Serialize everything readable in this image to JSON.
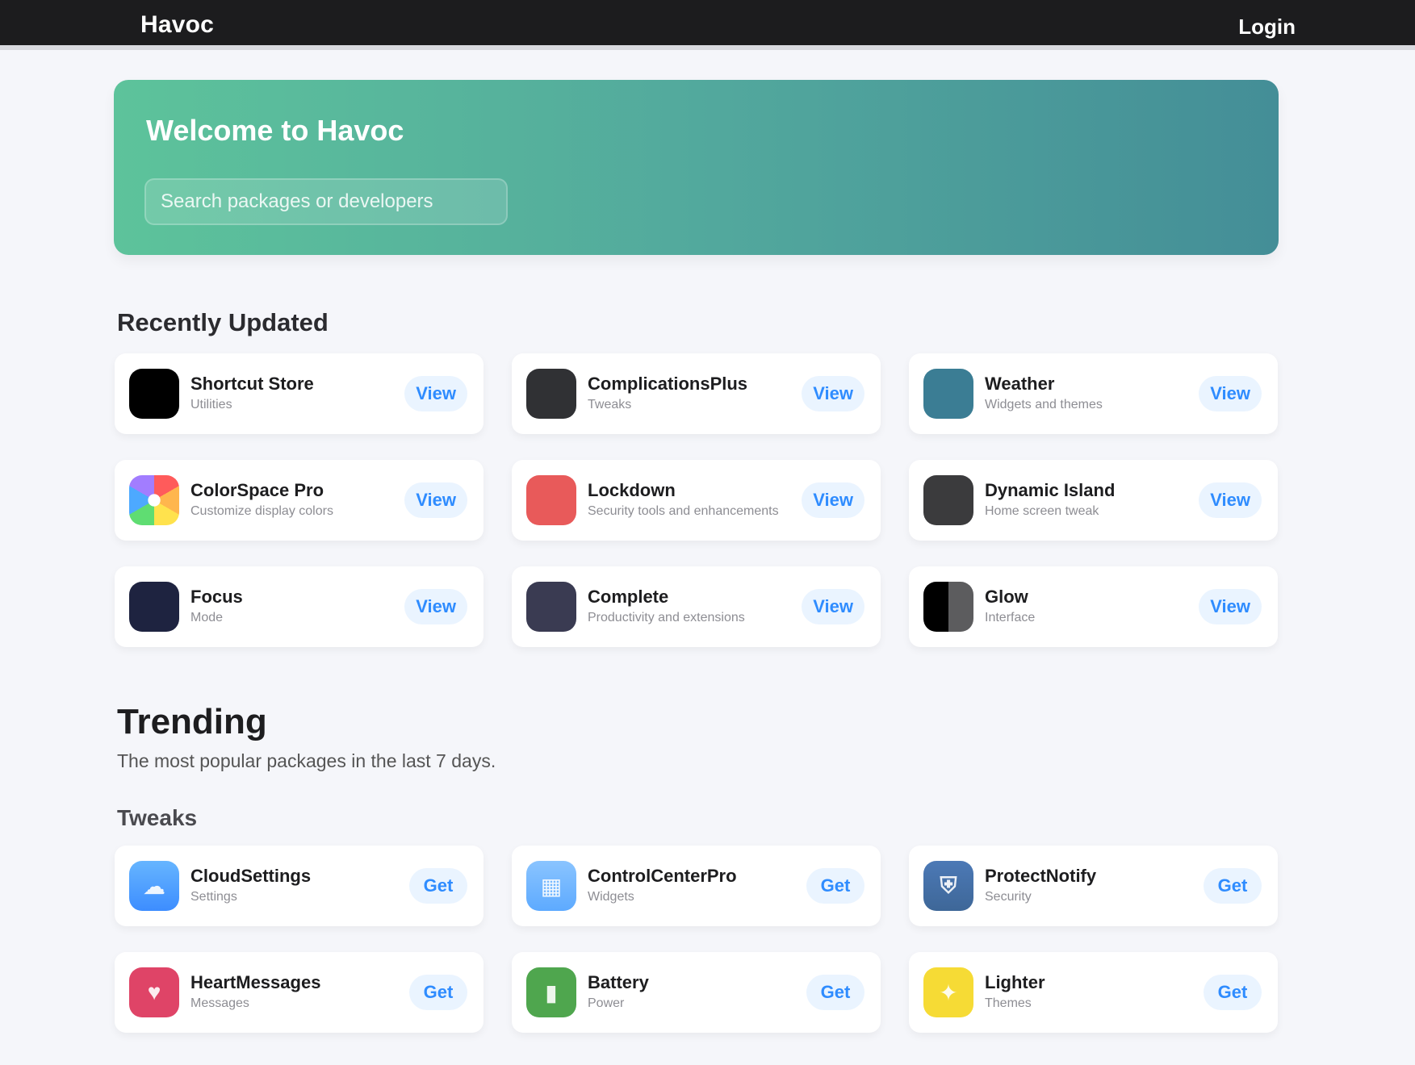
{
  "app": {
    "brand": "Havoc",
    "login": "Login"
  },
  "hero": {
    "title": "Welcome to Havoc",
    "search_placeholder": "Search packages or developers"
  },
  "sections": {
    "recent": {
      "label": "Recently Updated",
      "items": [
        {
          "title": "Shortcut Store",
          "subtitle": "Utilities",
          "button": "View",
          "icon": "app-icon"
        },
        {
          "title": "ComplicationsPlus",
          "subtitle": "Tweaks",
          "button": "View",
          "icon": "app-icon"
        },
        {
          "title": "Weather",
          "subtitle": "Widgets and themes",
          "button": "View",
          "icon": "app-icon"
        },
        {
          "title": "ColorSpace Pro",
          "subtitle": "Customize display colors",
          "button": "View",
          "icon": "color-icon"
        },
        {
          "title": "Lockdown",
          "subtitle": "Security tools and enhancements",
          "button": "View",
          "icon": "app-icon"
        },
        {
          "title": "Dynamic Island",
          "subtitle": "Home screen tweak",
          "button": "View",
          "icon": "app-icon"
        },
        {
          "title": "Focus",
          "subtitle": "Mode",
          "button": "View",
          "icon": "app-icon"
        },
        {
          "title": "Complete",
          "subtitle": "Productivity and extensions",
          "button": "View",
          "icon": "app-icon"
        },
        {
          "title": "Glow",
          "subtitle": "Interface",
          "button": "View",
          "icon": "app-icon"
        }
      ]
    },
    "trending": {
      "title": "Trending",
      "subtitle": "The most popular packages in the last 7 days.",
      "tweaks_label": "Tweaks",
      "items": [
        {
          "title": "CloudSettings",
          "subtitle": "Settings",
          "button": "Get",
          "icon": "cloud-icon"
        },
        {
          "title": "ControlCenterPro",
          "subtitle": "Widgets",
          "button": "Get",
          "icon": "control-icon"
        },
        {
          "title": "ProtectNotify",
          "subtitle": "Security",
          "button": "Get",
          "icon": "shield-icon"
        },
        {
          "title": "HeartMessages",
          "subtitle": "Messages",
          "button": "Get",
          "icon": "heart-icon"
        },
        {
          "title": "Battery",
          "subtitle": "Power",
          "button": "Get",
          "icon": "battery-icon"
        },
        {
          "title": "Lighter",
          "subtitle": "Themes",
          "button": "Get",
          "icon": "light-icon"
        }
      ]
    }
  }
}
